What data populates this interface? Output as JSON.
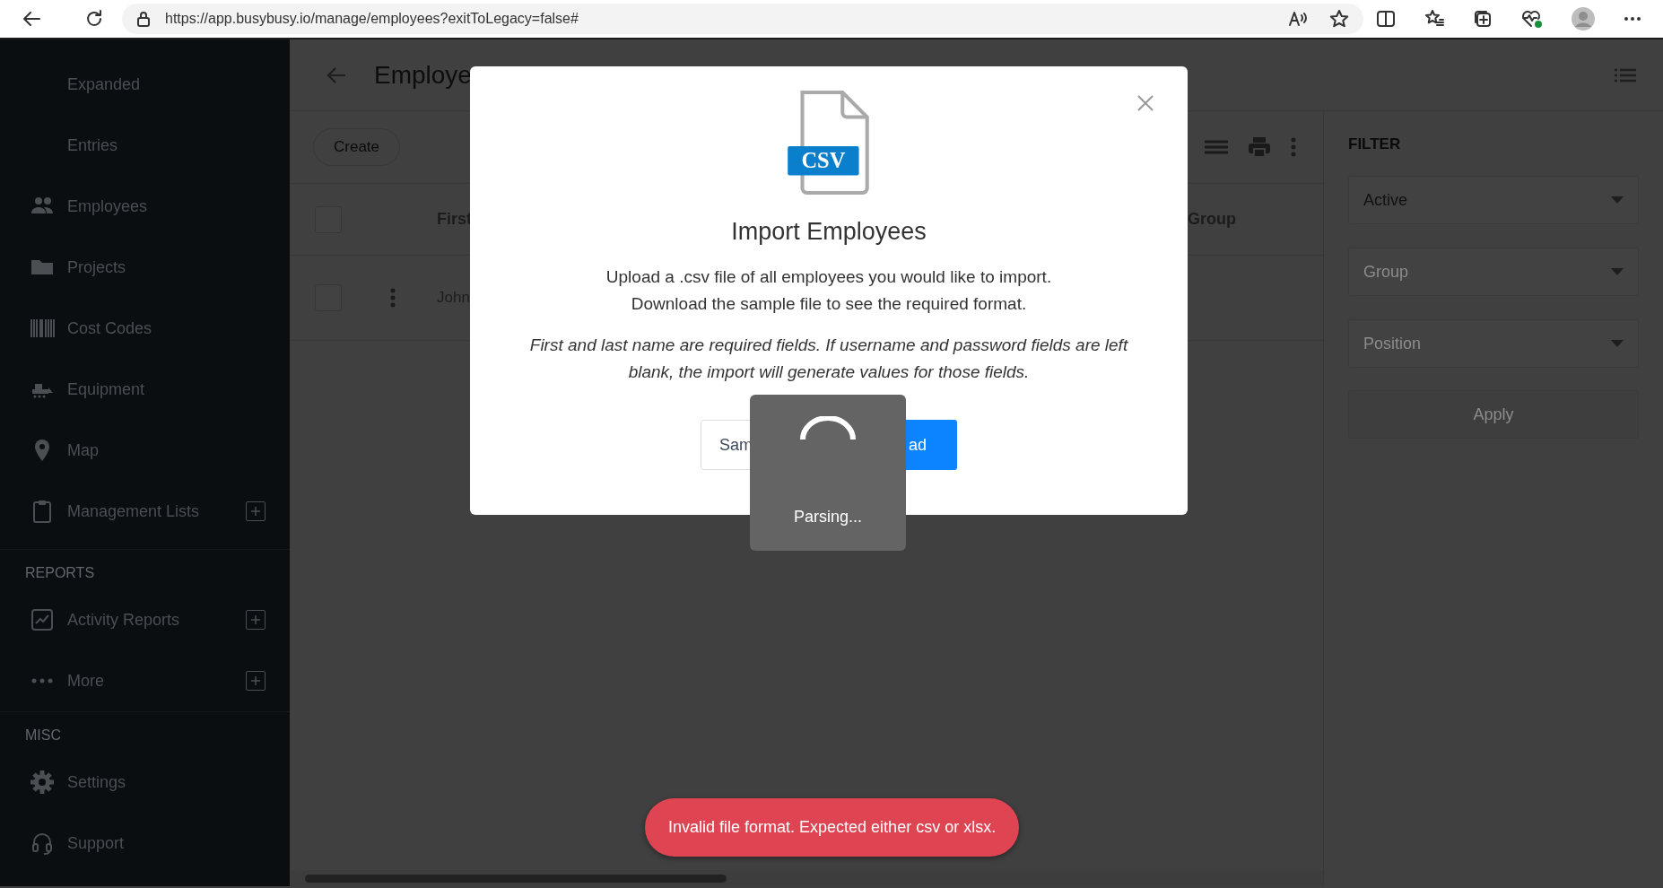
{
  "browser": {
    "url": "https://app.busybusy.io/manage/employees?exitToLegacy=false#"
  },
  "sidebar": {
    "groups": [
      {
        "items": [
          {
            "label": "Expanded",
            "expandable": false
          },
          {
            "label": "Entries",
            "expandable": false
          },
          {
            "label": "Employees",
            "expandable": false
          },
          {
            "label": "Projects",
            "expandable": false
          },
          {
            "label": "Cost Codes",
            "expandable": false
          },
          {
            "label": "Equipment",
            "expandable": false
          },
          {
            "label": "Map",
            "expandable": false
          },
          {
            "label": "Management Lists",
            "expandable": true
          }
        ]
      },
      {
        "heading": "REPORTS",
        "items": [
          {
            "label": "Activity Reports",
            "expandable": true
          },
          {
            "label": "More",
            "expandable": true
          }
        ]
      },
      {
        "heading": "MISC",
        "items": [
          {
            "label": "Settings",
            "expandable": false
          },
          {
            "label": "Support",
            "expandable": false
          }
        ]
      }
    ]
  },
  "page": {
    "title": "Employe",
    "create_button": "Create",
    "table": {
      "select_all_checked": false,
      "columns": [
        {
          "label": "First"
        },
        {
          "label": "Group"
        }
      ],
      "rows": [
        {
          "checked": false,
          "cells": [
            "John"
          ]
        }
      ]
    }
  },
  "filter": {
    "heading": "FILTER",
    "selects": [
      {
        "value": "Active"
      },
      {
        "placeholder": "Group"
      },
      {
        "placeholder": "Position"
      }
    ],
    "apply_button": "Apply"
  },
  "modal": {
    "file_badge": "CSV",
    "title": "Import Employees",
    "lines": [
      "Upload a .csv file of all employees you would like to import.",
      "Download the sample file to see the required format."
    ],
    "note": "First and last name are required fields. If username and password fields are left blank, the import will generate values for those fields.",
    "buttons": [
      {
        "label": "Sam",
        "kind": "secondary"
      },
      {
        "label": "ad",
        "kind": "primary"
      }
    ]
  },
  "loader": {
    "label": "Parsing..."
  },
  "toast": {
    "message": "Invalid file format. Expected either csv or xlsx."
  }
}
